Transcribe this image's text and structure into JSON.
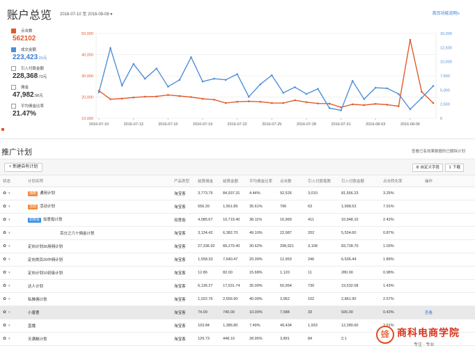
{
  "overview": {
    "title": "账户总览",
    "date_range": "2016-07-10 至 2016-08-08",
    "help_link": "首页功能说明",
    "metrics": [
      {
        "label": "点击数",
        "value": "562102",
        "unit": "",
        "checked": true,
        "color": "#e05a2b"
      },
      {
        "label": "成交金额",
        "value": "223,423",
        "unit": ".31元",
        "checked": true,
        "color": "#4f8fd6"
      },
      {
        "label": "引入付款金额",
        "value": "228,368",
        "unit": ".72元",
        "checked": false,
        "color": ""
      },
      {
        "label": "佣金",
        "value": "47,982",
        "unit": ".56元",
        "checked": false,
        "color": ""
      },
      {
        "label": "平均佣金比率",
        "value": "21.47%",
        "unit": "",
        "checked": false,
        "color": ""
      }
    ]
  },
  "chart_data": {
    "type": "line",
    "x": [
      "2016-07-10",
      "2016-07-11",
      "2016-07-12",
      "2016-07-13",
      "2016-07-14",
      "2016-07-15",
      "2016-07-16",
      "2016-07-17",
      "2016-07-18",
      "2016-07-19",
      "2016-07-20",
      "2016-07-21",
      "2016-07-22",
      "2016-07-23",
      "2016-07-24",
      "2016-07-25",
      "2016-07-26",
      "2016-07-27",
      "2016-07-28",
      "2016-07-29",
      "2016-07-30",
      "2016-07-31",
      "2016-08-01",
      "2016-08-02",
      "2016-08-03",
      "2016-08-04",
      "2016-08-05",
      "2016-08-06",
      "2016-08-07",
      "2016-08-08"
    ],
    "x_tick_labels": [
      "2016-07-10",
      "2016-07-13",
      "2016-07-16",
      "2016-07-19",
      "2016-07-22",
      "2016-07-25",
      "2016-07-28",
      "2016-07-31",
      "2016-08-03",
      "2016-08-06"
    ],
    "left_axis": {
      "ticks": [
        "10,000",
        "20,000",
        "30,000",
        "40,000",
        "50,000"
      ],
      "range": [
        10000,
        50000
      ],
      "color": "#e05a2b"
    },
    "right_axis": {
      "ticks": [
        "0",
        "2,500",
        "5,000",
        "7,500",
        "10,000",
        "12,500",
        "15,000"
      ],
      "range": [
        0,
        15000
      ],
      "color": "#4f8fd6"
    },
    "series": [
      {
        "axis": "left",
        "color": "#e05a2b",
        "values": [
          23000,
          19000,
          19300,
          19800,
          20200,
          20300,
          21000,
          20500,
          20000,
          19200,
          18800,
          17200,
          17800,
          18000,
          17800,
          17200,
          17200,
          18500,
          17600,
          17000,
          16900,
          15200,
          16600,
          16200,
          16800,
          16400,
          15700,
          47000,
          22500,
          17200
        ]
      },
      {
        "axis": "right",
        "color": "#4f8fd6",
        "values": [
          4600,
          12400,
          5800,
          9600,
          7000,
          8800,
          5600,
          6800,
          10800,
          6500,
          7000,
          6800,
          7800,
          3800,
          6000,
          7600,
          4500,
          5500,
          4300,
          5200,
          1800,
          1400,
          6600,
          3400,
          5400,
          5300,
          4300,
          1600,
          3600,
          5700
        ]
      }
    ]
  },
  "plans": {
    "title": "推广计划",
    "note": "查看已有效果数据的已删除计划",
    "new_plan": "新建自有计划",
    "custom_cols": "自定义字段",
    "download": "下载",
    "columns": [
      "状态",
      "计划名称",
      "产品类型",
      "结算佣金",
      "结算金额",
      "平均佣金比率",
      "点击数",
      "引入付款笔数",
      "引入付款金额",
      "点击转化率",
      "操作"
    ],
    "rows": [
      {
        "tag": "通用",
        "tag_color": "orange",
        "name": "通用计划",
        "type": "淘宝客",
        "commission": "3,773.79",
        "amount": "84,937.31",
        "rate": "4.44%",
        "clicks": "92,526",
        "orders": "3,010",
        "pay": "81,556.23",
        "cvr": "3.25%",
        "action": ""
      },
      {
        "tag": "活动",
        "tag_color": "orange",
        "name": "活动计划",
        "type": "淘宝客",
        "commission": "556.20",
        "amount": "1,561.85",
        "rate": "35.61%",
        "clicks": "796",
        "orders": "63",
        "pay": "1,998.53",
        "cvr": "7.91%",
        "action": ""
      },
      {
        "tag": "如意投",
        "tag_color": "blue",
        "name": "如意投计划",
        "type": "如意投",
        "commission": "4,085.67",
        "amount": "10,719.40",
        "rate": "38.11%",
        "clicks": "16,969",
        "orders": "411",
        "pay": "10,948.10",
        "cvr": "2.42%",
        "action": ""
      },
      {
        "tag": "",
        "tag_color": "",
        "name": "百分之六十佣金计划",
        "type": "淘宝客",
        "commission": "3,134.42",
        "amount": "6,382.70",
        "rate": "49.10%",
        "clicks": "22,987",
        "orders": "202",
        "pay": "5,534.60",
        "cvr": "0.87%",
        "action": ""
      },
      {
        "tag": "",
        "tag_color": "",
        "name": "定向计划30用佣计划",
        "type": "淘宝客",
        "commission": "27,336.92",
        "amount": "89,270.40",
        "rate": "30.62%",
        "clicks": "298,921",
        "orders": "3,108",
        "pay": "83,728.70",
        "cvr": "1.03%",
        "action": ""
      },
      {
        "tag": "",
        "tag_color": "",
        "name": "定向类目20中佣计划",
        "type": "淘宝客",
        "commission": "1,558.33",
        "amount": "7,640.47",
        "rate": "20.39%",
        "clicks": "12,953",
        "orders": "246",
        "pay": "6,536.44",
        "cvr": "1.89%",
        "action": ""
      },
      {
        "tag": "",
        "tag_color": "",
        "name": "定向计划10初级计划",
        "type": "淘宝客",
        "commission": "12.86",
        "amount": "82.00",
        "rate": "15.68%",
        "clicks": "1,120",
        "orders": "11",
        "pay": "280.00",
        "cvr": "0.98%",
        "action": ""
      },
      {
        "tag": "",
        "tag_color": "",
        "name": "达人计划",
        "type": "淘宝客",
        "commission": "6,136.27",
        "amount": "17,531.74",
        "rate": "35.00%",
        "clicks": "50,954",
        "orders": "730",
        "pay": "19,532.08",
        "cvr": "1.43%",
        "action": ""
      },
      {
        "tag": "",
        "tag_color": "",
        "name": "私推佣计划",
        "type": "淘宝客",
        "commission": "1,022.76",
        "amount": "2,556.90",
        "rate": "40.00%",
        "clicks": "3,962",
        "orders": "102",
        "pay": "2,861.90",
        "cvr": "2.57%",
        "action": ""
      },
      {
        "tag": "",
        "tag_color": "",
        "name": "小唐曹",
        "type": "淘宝客",
        "commission": "74.00",
        "amount": "740.00",
        "rate": "10.00%",
        "clicks": "7,588",
        "orders": "33",
        "pay": "926.00",
        "cvr": "0.43%",
        "action": "查看"
      },
      {
        "tag": "",
        "tag_color": "",
        "name": "直播",
        "type": "淘宝客",
        "commission": "103.84",
        "amount": "1,386.80",
        "rate": "7.49%",
        "clicks": "49,434",
        "orders": "1,933",
        "pay": "12,280.60",
        "cvr": "3.91%",
        "action": ""
      },
      {
        "tag": "",
        "tag_color": "",
        "name": "天满糕计划",
        "type": "淘宝客",
        "commission": "129.73",
        "amount": "448.10",
        "rate": "28.95%",
        "clicks": "3,891",
        "orders": "84",
        "pay": "2,1",
        "cvr": "",
        "action": ""
      }
    ]
  },
  "watermark": {
    "name": "商科电商学院",
    "sub": "专注 · 专业",
    "seal_glyph": "蜂"
  }
}
